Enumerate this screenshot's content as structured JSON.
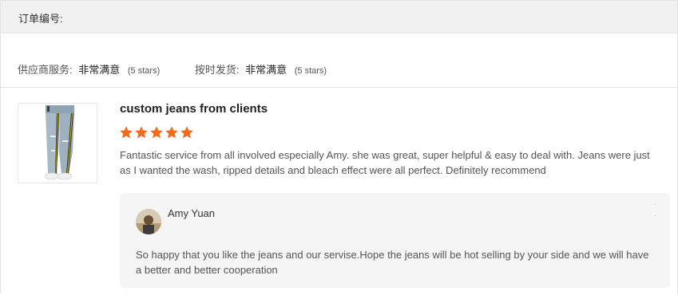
{
  "order": {
    "label": "订单编号:"
  },
  "ratings": [
    {
      "label": "供应商服务:",
      "value": "非常满意",
      "stars": "(5 stars)"
    },
    {
      "label": "按时发货:",
      "value": "非常满意",
      "stars": "(5 stars)"
    }
  ],
  "review": {
    "title": "custom jeans from clients",
    "star_count": 5,
    "star_color": "#f26b1d",
    "text": "Fantastic service from all involved especially Amy. she was great, super helpful & easy to deal with. Jeans were just as I wanted the wash, ripped details and bleach effect were all perfect. Definitely recommend"
  },
  "reply": {
    "name": "Amy Yuan",
    "text": "So happy that you like the jeans and our servise.Hope the jeans will be hot selling by your side and we will have a better and better cooperation"
  }
}
